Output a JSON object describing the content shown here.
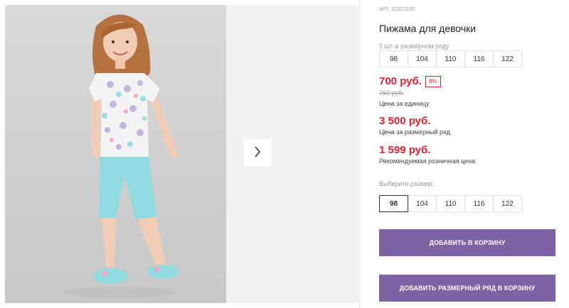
{
  "gallery": {
    "next_icon": "chevron-right-icon"
  },
  "product": {
    "sku_label": "АРТ.",
    "sku": "32322332",
    "title": "Пижама для девочки",
    "pack_note": "5 шт. в размерном ряду",
    "pack_sizes": [
      "98",
      "104",
      "110",
      "116",
      "122"
    ],
    "price": "700 руб.",
    "discount": "8%",
    "old_price": "760 руб.",
    "price_caption": "Цена за единицу",
    "pack_price": "3 500 руб.",
    "pack_price_caption": "Цена за размерный ряд",
    "rrp": "1 599 руб.",
    "rrp_caption": "Рекомендуемая розничная цена",
    "choose_size_label": "Выберите размер:",
    "sizes": [
      "98",
      "104",
      "110",
      "116",
      "122"
    ],
    "selected_size": "98",
    "add_to_cart": "ДОБАВИТЬ В КОРЗИНУ",
    "add_pack_to_cart": "ДОБАВИТЬ РАЗМЕРНЫЙ РЯД В КОРЗИНУ"
  },
  "colors": {
    "price_red": "#e3202f",
    "button_purple": "#7d63a3",
    "pajama_mint": "#8fdbe0"
  }
}
